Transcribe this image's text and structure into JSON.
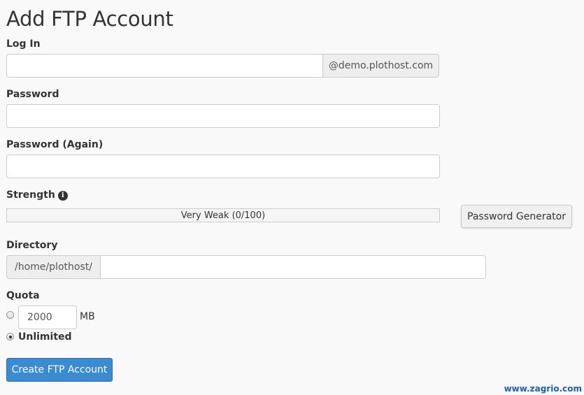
{
  "page": {
    "title": "Add FTP Account"
  },
  "login": {
    "label": "Log In",
    "value": "",
    "domain_suffix": "@demo.plothost.com"
  },
  "password": {
    "label": "Password",
    "value": ""
  },
  "password_again": {
    "label": "Password (Again)",
    "value": ""
  },
  "strength": {
    "label": "Strength",
    "info_icon": "info-circle-icon",
    "text": "Very Weak (0/100)",
    "score": 0,
    "fill_color": "#d9534f",
    "generator_button": "Password Generator"
  },
  "directory": {
    "label": "Directory",
    "prefix": "/home/plothost/",
    "value": ""
  },
  "quota": {
    "label": "Quota",
    "limit_value": "2000",
    "unit": "MB",
    "unlimited_label": "Unlimited",
    "selected": "unlimited"
  },
  "submit": {
    "label": "Create FTP Account",
    "color": "#3a8bd1"
  },
  "watermark": {
    "text": "www.zagrio.com"
  }
}
